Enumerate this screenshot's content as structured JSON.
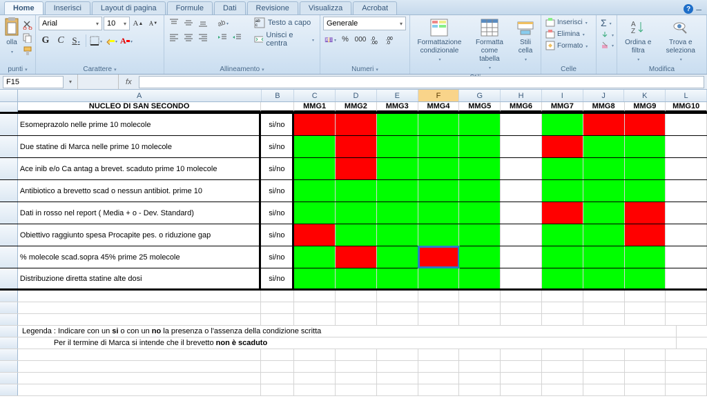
{
  "tabs": [
    "Home",
    "Inserisci",
    "Layout di pagina",
    "Formule",
    "Dati",
    "Revisione",
    "Visualizza",
    "Acrobat"
  ],
  "active_tab": 0,
  "ribbon_groups": {
    "clipboard": {
      "label": "punti",
      "paste": "olla"
    },
    "font": {
      "label": "Carattere",
      "font_name": "Arial",
      "font_size": "10",
      "bold": "G",
      "italic": "C",
      "underline": "S"
    },
    "alignment": {
      "label": "Allineamento",
      "wrap": "Testo a capo",
      "merge": "Unisci e centra"
    },
    "number": {
      "label": "Numeri",
      "format": "Generale"
    },
    "styles": {
      "label": "Stili",
      "cond": "Formattazione condizionale",
      "table": "Formatta come tabella",
      "cell": "Stili cella"
    },
    "cells": {
      "label": "Celle",
      "insert": "Inserisci",
      "delete": "Elimina",
      "format": "Formato"
    },
    "editing": {
      "label": "Modifica",
      "sort": "Ordina e filtra",
      "find": "Trova e seleziona"
    }
  },
  "name_box": "F15",
  "fx_label": "fx",
  "formula_value": "",
  "columns": [
    "A",
    "B",
    "C",
    "D",
    "E",
    "F",
    "G",
    "H",
    "I",
    "J",
    "K",
    "L"
  ],
  "selected_column": "F",
  "header_title": "NUCLEO DI SAN SECONDO",
  "mmg_headers": [
    "MMG1",
    "MMG2",
    "MMG3",
    "MMG4",
    "MMG5",
    "MMG6",
    "MMG7",
    "MMG8",
    "MMG9",
    "MMG10"
  ],
  "rows": [
    {
      "label": "Esomeprazolo nelle prime 10 molecole",
      "b": "si/no",
      "colors": [
        "red",
        "red",
        "green",
        "green",
        "green",
        "",
        "green",
        "red",
        "red",
        ""
      ]
    },
    {
      "label": "Due statine di Marca  nelle prime 10 molecole",
      "b": "si/no",
      "colors": [
        "green",
        "red",
        "green",
        "green",
        "green",
        "",
        "red",
        "green",
        "green",
        ""
      ]
    },
    {
      "label": "Ace inib e/o Ca antag a brevet. scaduto prime 10 molecole",
      "b": "si/no",
      "colors": [
        "green",
        "red",
        "green",
        "green",
        "green",
        "",
        "green",
        "green",
        "green",
        ""
      ]
    },
    {
      "label": "Antibiotico a brevetto scad o nessun antibiot. prime 10",
      "b": "si/no",
      "colors": [
        "green",
        "green",
        "green",
        "green",
        "green",
        "",
        "green",
        "green",
        "green",
        ""
      ]
    },
    {
      "label": "Dati in rosso nel report ( Media + o - Dev. Standard)",
      "b": "si/no",
      "colors": [
        "green",
        "green",
        "green",
        "green",
        "green",
        "",
        "red",
        "green",
        "red",
        ""
      ]
    },
    {
      "label": "Obiettivo raggiunto spesa Procapite pes. o riduzione gap",
      "b": "si/no",
      "colors": [
        "red",
        "green",
        "green",
        "green",
        "green",
        "",
        "green",
        "green",
        "red",
        ""
      ]
    },
    {
      "label": "% molecole scad.sopra 45% prime 25 molecole",
      "b": "si/no",
      "colors": [
        "green",
        "red",
        "green",
        "red",
        "green",
        "",
        "green",
        "green",
        "green",
        ""
      ]
    },
    {
      "label": "Distribuzione diretta statine alte dosi",
      "b": "si/no",
      "colors": [
        "green",
        "green",
        "green",
        "green",
        "green",
        "",
        "green",
        "green",
        "green",
        ""
      ]
    }
  ],
  "selected_cell": {
    "row": 6,
    "col": "F"
  },
  "legend1_prefix": "Legenda :   Indicare con un ",
  "legend1_si": "si",
  "legend1_mid": " o con un ",
  "legend1_no": "no",
  "legend1_suffix": " la presenza o l'assenza della condizione scritta",
  "legend2_prefix": "               Per il termine di Marca si intende che il brevetto ",
  "legend2_bold": "non è scaduto"
}
